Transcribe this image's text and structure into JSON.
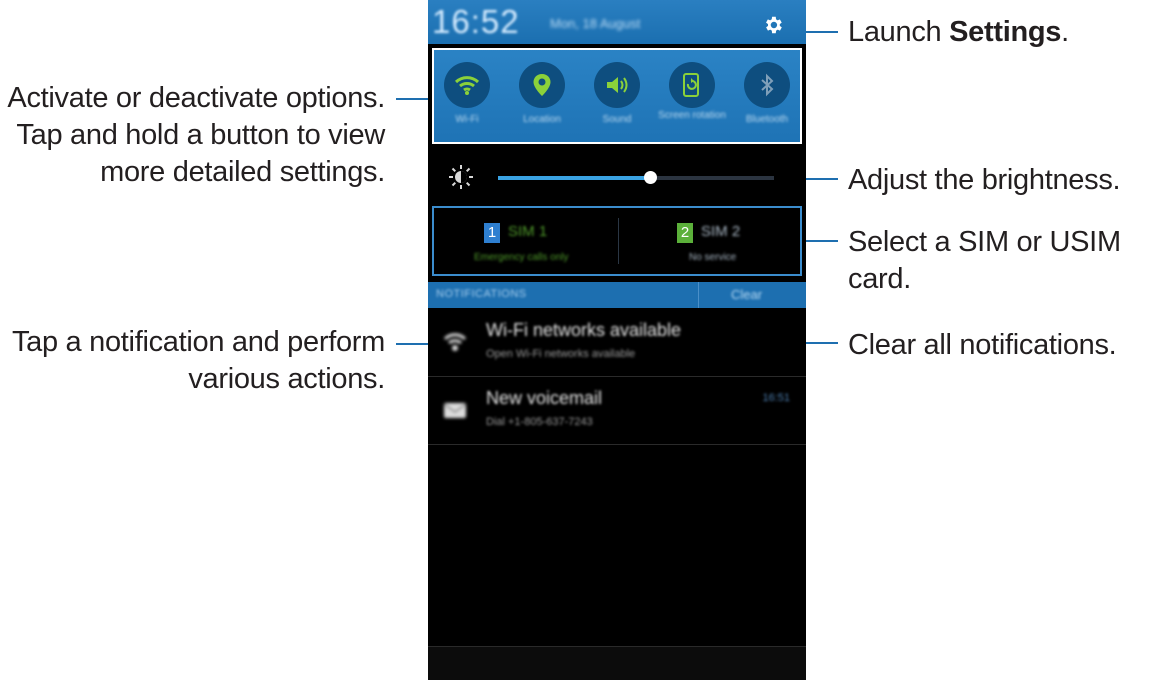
{
  "callouts": {
    "settings_pre": "Launch ",
    "settings_bold": "Settings",
    "settings_post": ".",
    "options_lines": [
      "Activate or deactivate options.",
      "Tap and hold a button to view",
      "more detailed settings."
    ],
    "brightness": "Adjust the brightness.",
    "sim": "Select a SIM or USIM card.",
    "notification_lines": [
      "Tap a notification and perform",
      "various actions."
    ],
    "clear": "Clear all notifications."
  },
  "phone": {
    "status": {
      "time": "16:52",
      "date": "Mon, 18 August"
    },
    "quick_settings": [
      {
        "label": "Wi-Fi",
        "icon": "wifi-icon"
      },
      {
        "label": "Location",
        "icon": "location-icon"
      },
      {
        "label": "Sound",
        "icon": "sound-icon"
      },
      {
        "label": "Screen rotation",
        "icon": "screen-rotation-icon"
      },
      {
        "label": "Bluetooth",
        "icon": "bluetooth-icon"
      }
    ],
    "brightness_level": 0.55,
    "sims": [
      {
        "number": "1",
        "name": "SIM 1",
        "status": "Emergency calls only",
        "badge_color": "#2e7fd0",
        "text_color": "#4f9a2a"
      },
      {
        "number": "2",
        "name": "SIM 2",
        "status": "No service",
        "badge_color": "#5bb03a",
        "text_color": "#a9b7c4"
      }
    ],
    "notifications_header": "NOTIFICATIONS",
    "clear_label": "Clear",
    "notifications": [
      {
        "title": "Wi-Fi networks available",
        "subtitle": "Open Wi-Fi networks available",
        "time": "",
        "icon": "wifi-notification-icon"
      },
      {
        "title": "New voicemail",
        "subtitle": "Dial +1-805-637-7243",
        "time": "16:51",
        "icon": "voicemail-icon"
      }
    ],
    "accent_color": "#1e6fb0",
    "quick_icon_color": "#8bd13a"
  }
}
